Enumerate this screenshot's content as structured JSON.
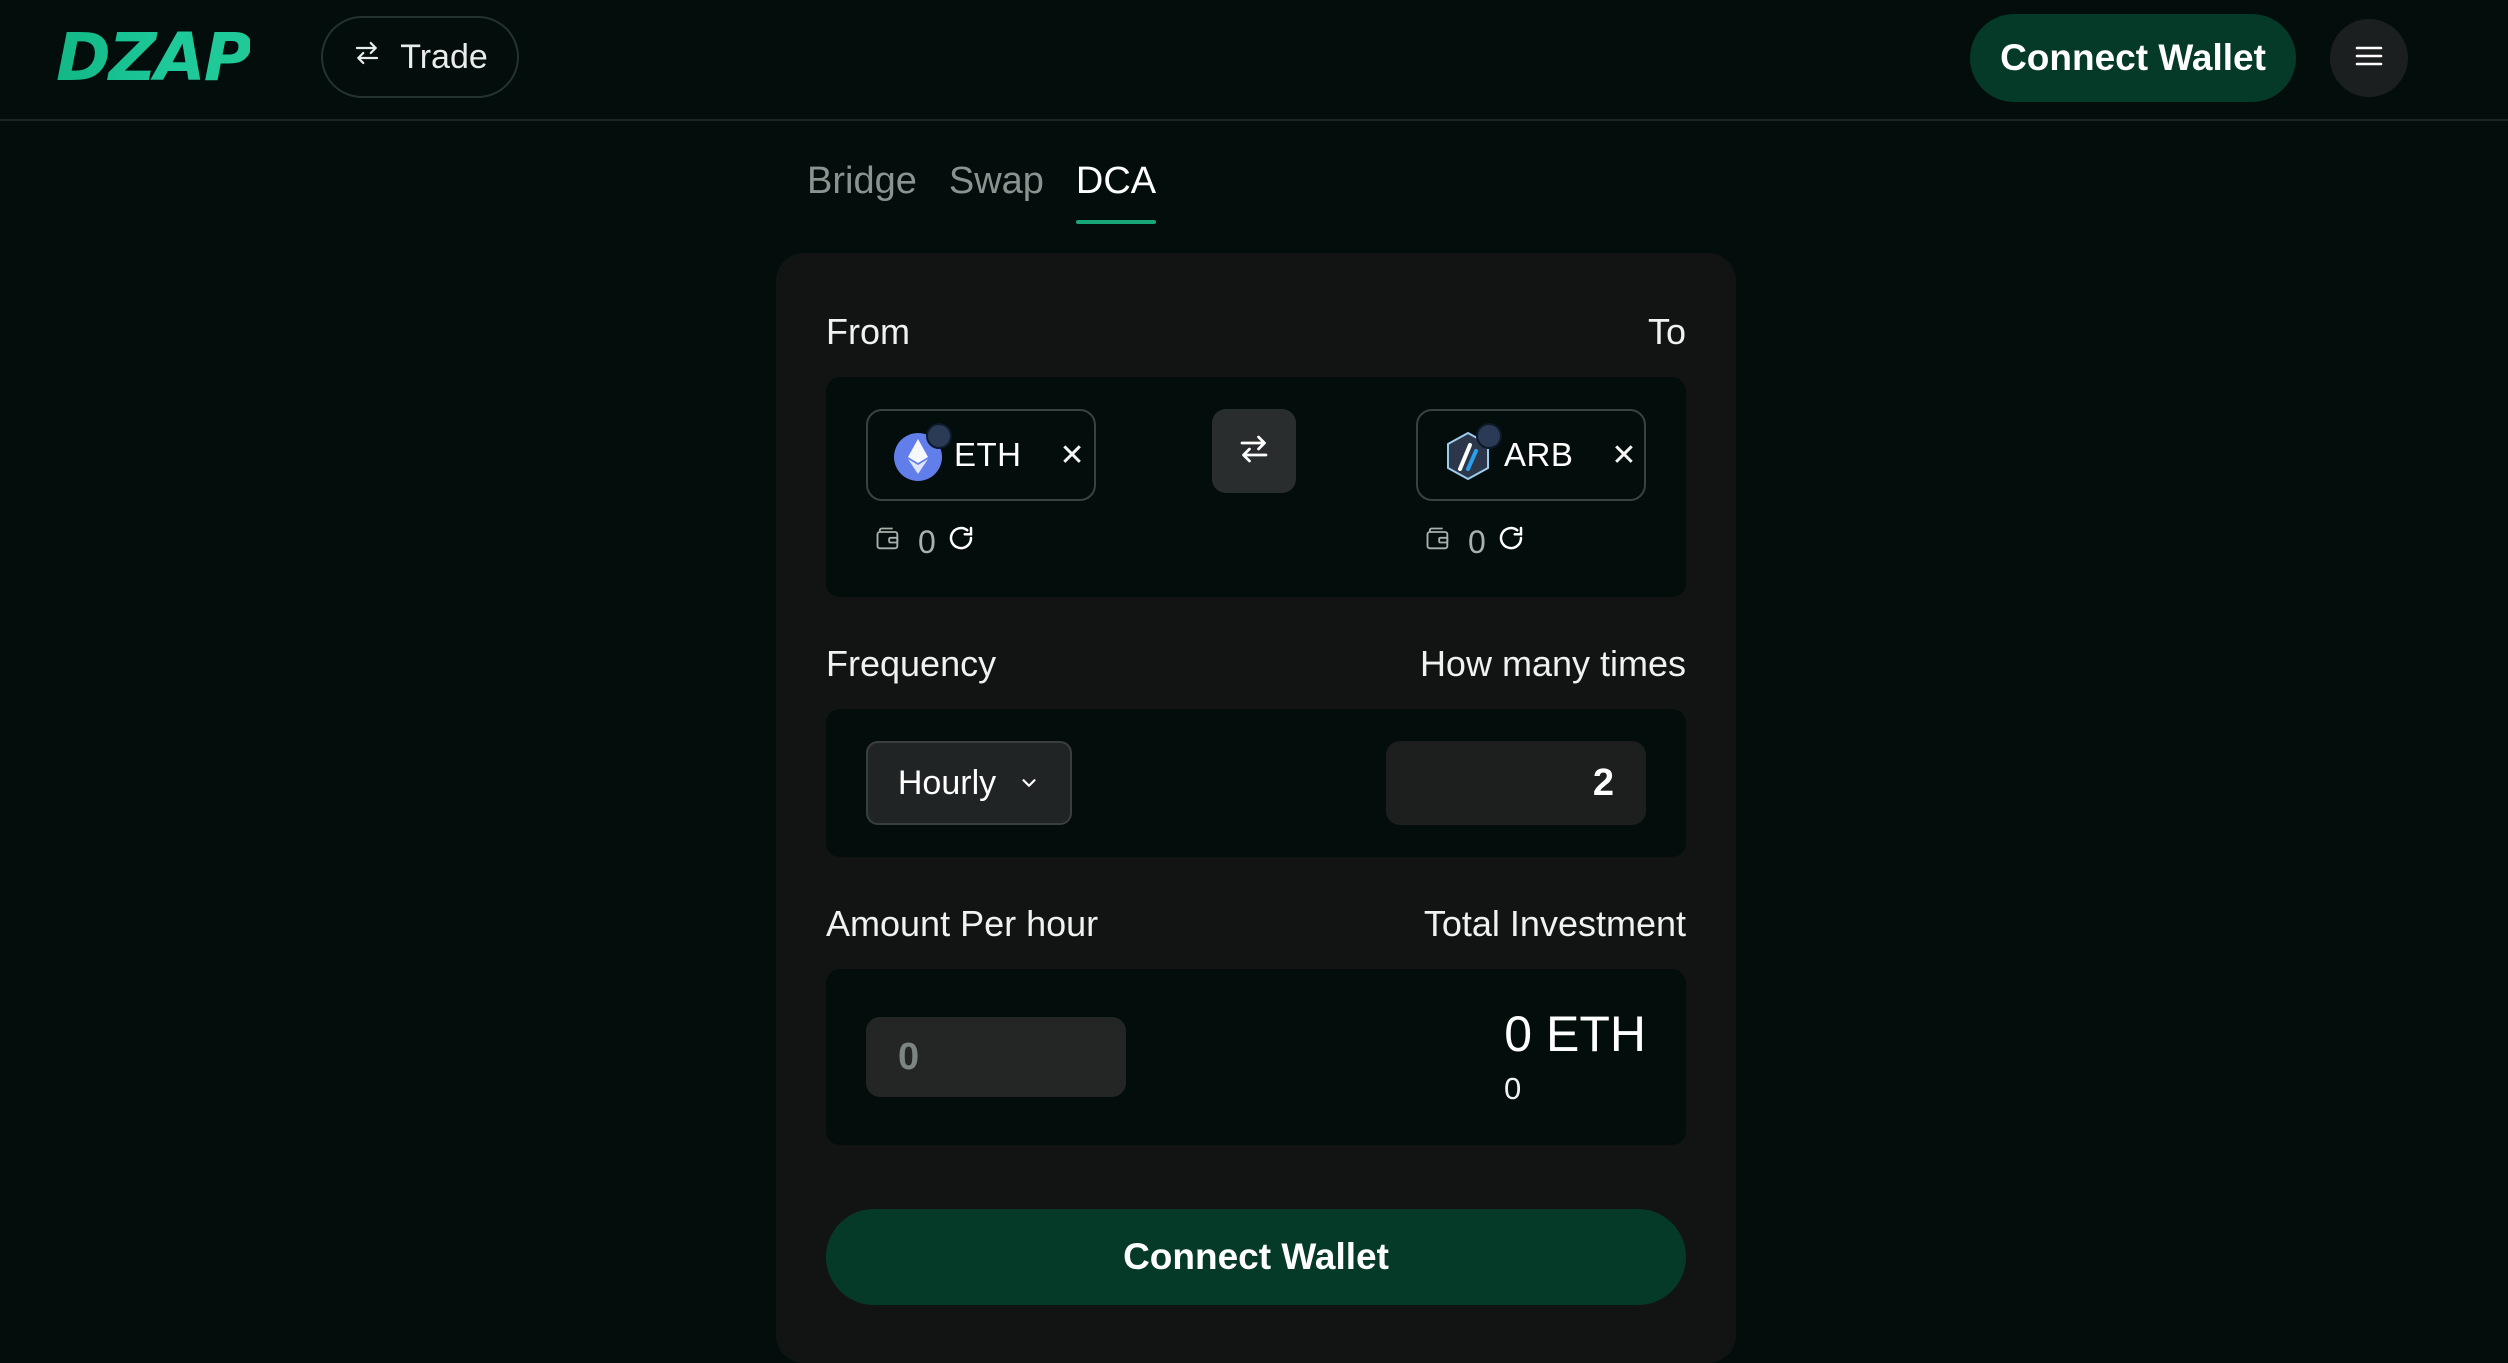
{
  "header": {
    "logo_text": "DZAP",
    "trade_label": "Trade",
    "connect_wallet_label": "Connect Wallet"
  },
  "tabs": [
    {
      "label": "Bridge",
      "active": false
    },
    {
      "label": "Swap",
      "active": false
    },
    {
      "label": "DCA",
      "active": true
    }
  ],
  "trade_form": {
    "from_label": "From",
    "to_label": "To",
    "from_token": {
      "symbol": "ETH",
      "balance": "0",
      "icon": "ethereum-icon",
      "color": "#627eea"
    },
    "to_token": {
      "symbol": "ARB",
      "balance": "0",
      "icon": "arbitrum-icon",
      "color": "#2d374b"
    },
    "frequency_label": "Frequency",
    "frequency_value": "Hourly",
    "times_label": "How many times",
    "times_value": "2",
    "amount_label": "Amount Per hour",
    "amount_placeholder": "0",
    "total_label": "Total Investment",
    "total_value": "0 ETH",
    "total_sub_value": "0",
    "connect_wallet_label": "Connect Wallet"
  },
  "colors": {
    "background": "#030d0b",
    "card": "#121414",
    "accent": "#12b886",
    "button": "#053a29"
  }
}
